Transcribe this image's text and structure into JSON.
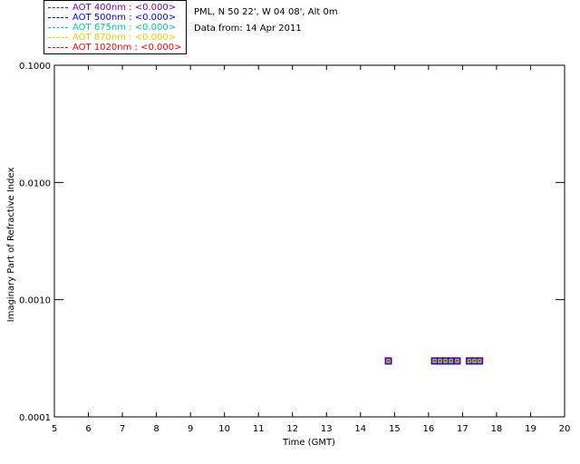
{
  "legend": {
    "items": [
      {
        "label": "AOT  400nm : <0.000>",
        "color": "#8000c0"
      },
      {
        "label": "AOT  500nm : <0.000>",
        "color": "#0000ff"
      },
      {
        "label": "AOT  675nm : <0.000>",
        "color": "#00cc99"
      },
      {
        "label": "AOT  870nm : <0.000>",
        "color": "#e8d000"
      },
      {
        "label": "AOT 1020nm : <0.000>",
        "color": "#ff0000"
      }
    ]
  },
  "info": {
    "site": "PML, N 50 22', W 04 08', Alt 0m",
    "date": "Data from: 14 Apr 2011"
  },
  "chart_data": {
    "type": "scatter",
    "xlabel": "Time (GMT)",
    "ylabel": "Imaginary Part of Refractive Index",
    "xlim": [
      5,
      20
    ],
    "ylim": [
      0.0001,
      0.1
    ],
    "yscale": "log",
    "grid": false,
    "x_ticks": [
      "5",
      "6",
      "7",
      "8",
      "9",
      "10",
      "11",
      "12",
      "13",
      "14",
      "15",
      "16",
      "17",
      "18",
      "19",
      "20"
    ],
    "y_ticks": [
      "0.0001",
      "0.0010",
      "0.0100",
      "0.1000"
    ],
    "marker_fill": "#ff8c00",
    "marker_edge": "#c00000",
    "series": [
      {
        "name": "AOT  400nm : <0.000>",
        "color": "#8000c0",
        "x": [
          14.82,
          16.18,
          16.34,
          16.5,
          16.66,
          16.84,
          17.2,
          17.35,
          17.5
        ],
        "y": [
          0.0003,
          0.0003,
          0.0003,
          0.0003,
          0.0003,
          0.0003,
          0.0003,
          0.0003,
          0.0003
        ]
      },
      {
        "name": "AOT  500nm : <0.000>",
        "color": "#0000ff",
        "x": [
          14.82,
          16.18,
          16.34,
          16.5,
          16.66,
          16.84,
          17.2,
          17.35,
          17.5
        ],
        "y": [
          0.0003,
          0.0003,
          0.0003,
          0.0003,
          0.0003,
          0.0003,
          0.0003,
          0.0003,
          0.0003
        ]
      },
      {
        "name": "AOT  675nm : <0.000>",
        "color": "#00cc99",
        "x": [
          14.82,
          16.18,
          16.34,
          16.5,
          16.66,
          16.84,
          17.2,
          17.35,
          17.5
        ],
        "y": [
          0.0003,
          0.0003,
          0.0003,
          0.0003,
          0.0003,
          0.0003,
          0.0003,
          0.0003,
          0.0003
        ]
      },
      {
        "name": "AOT  870nm : <0.000>",
        "color": "#e8d000",
        "x": [
          14.82,
          16.18,
          16.34,
          16.5,
          16.66,
          16.84,
          17.2,
          17.35,
          17.5
        ],
        "y": [
          0.0003,
          0.0003,
          0.0003,
          0.0003,
          0.0003,
          0.0003,
          0.0003,
          0.0003,
          0.0003
        ]
      },
      {
        "name": "AOT 1020nm : <0.000>",
        "color": "#ff0000",
        "x": [
          14.82,
          16.18,
          16.34,
          16.5,
          16.66,
          16.84,
          17.2,
          17.35,
          17.5
        ],
        "y": [
          0.0003,
          0.0003,
          0.0003,
          0.0003,
          0.0003,
          0.0003,
          0.0003,
          0.0003,
          0.0003
        ]
      }
    ]
  }
}
